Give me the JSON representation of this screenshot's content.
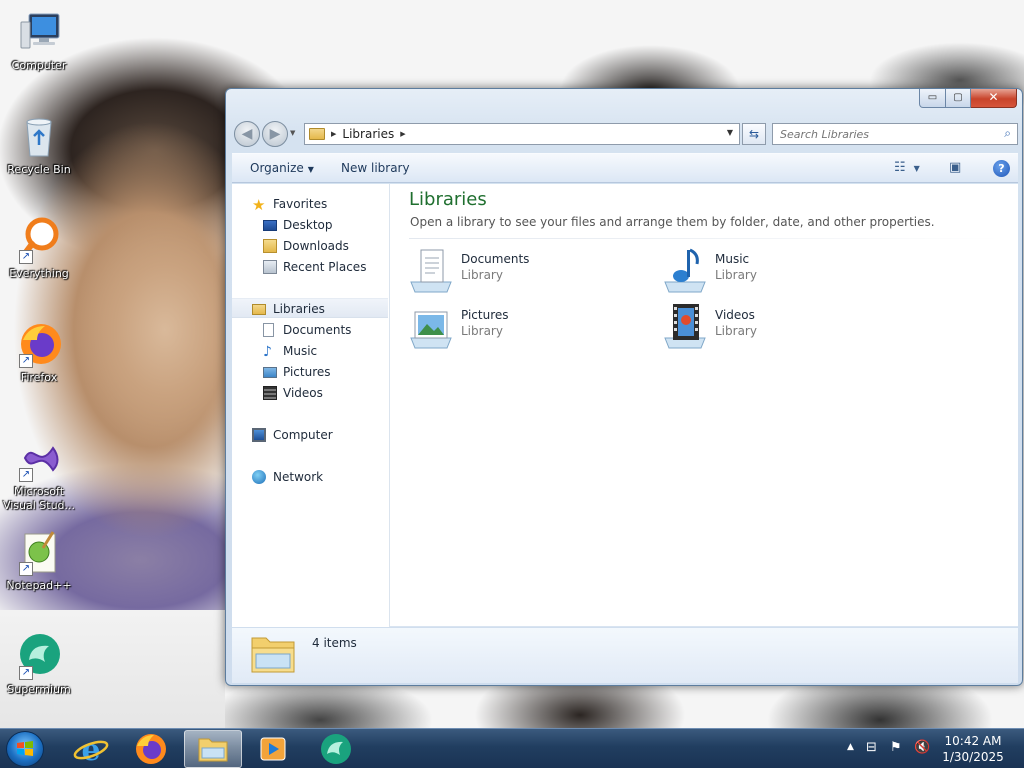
{
  "desktop": {
    "icons": [
      {
        "label": "Computer"
      },
      {
        "label": "Recycle Bin"
      },
      {
        "label": "Everything"
      },
      {
        "label": "Firefox"
      },
      {
        "label": "Microsoft Visual Stud..."
      },
      {
        "label": "Notepad++"
      },
      {
        "label": "Supermium"
      }
    ]
  },
  "window": {
    "caption": {
      "minimize": "▭",
      "maximize": "▢",
      "close": "✕"
    },
    "address": {
      "segments": [
        "Libraries"
      ]
    },
    "search": {
      "placeholder": "Search Libraries"
    },
    "toolbar": {
      "organize": "Organize",
      "new_library": "New library"
    },
    "navpane": {
      "favorites": {
        "label": "Favorites",
        "items": [
          "Desktop",
          "Downloads",
          "Recent Places"
        ]
      },
      "libraries": {
        "label": "Libraries",
        "items": [
          "Documents",
          "Music",
          "Pictures",
          "Videos"
        ]
      },
      "computer": "Computer",
      "network": "Network"
    },
    "main": {
      "title": "Libraries",
      "subtitle": "Open a library to see your files and arrange them by folder, date, and other properties.",
      "tiles": [
        {
          "name": "Documents",
          "type": "Library"
        },
        {
          "name": "Music",
          "type": "Library"
        },
        {
          "name": "Pictures",
          "type": "Library"
        },
        {
          "name": "Videos",
          "type": "Library"
        }
      ]
    },
    "details": {
      "count": "4 items"
    }
  },
  "taskbar": {
    "clock": {
      "time": "10:42 AM",
      "date": "1/30/2025"
    },
    "tray": {
      "expand": "▲"
    }
  },
  "colors": {
    "title_green": "#1f6f2f",
    "accent_blue": "#1f56b8",
    "taskbar": "#213e60"
  }
}
